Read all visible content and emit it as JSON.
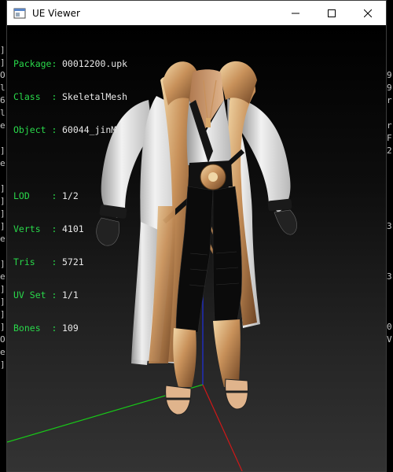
{
  "background_console": {
    "left_lines": [
      "]",
      "]",
      "O",
      "l",
      "6",
      "l",
      "e",
      "",
      "]",
      "e",
      "",
      "]",
      "]",
      "]",
      "]",
      "e",
      "",
      "]",
      "e",
      "]",
      "]",
      "]",
      "]",
      "O",
      "e",
      "]"
    ],
    "right_lines": [
      "9",
      "9",
      "r",
      "",
      "r",
      "F",
      "2",
      "",
      "",
      "",
      "",
      "",
      "3",
      "",
      "",
      "",
      "3",
      "",
      "",
      "",
      "0",
      "V"
    ]
  },
  "window": {
    "title": "UE Viewer",
    "icon": "ue-viewer-app-icon"
  },
  "controls": {
    "minimize_icon": "minimize-icon",
    "maximize_icon": "maximize-icon",
    "close_icon": "close-icon"
  },
  "info": {
    "package": {
      "label": "Package:",
      "value": "00012200.upk"
    },
    "class": {
      "label": "Class  :",
      "value": "SkeletalMesh"
    },
    "object": {
      "label": "Object :",
      "value": "60044_jinM"
    },
    "lod": {
      "label": "LOD    :",
      "value": "1/2"
    },
    "verts": {
      "label": "Verts  :",
      "value": "4101"
    },
    "tris": {
      "label": "Tris   :",
      "value": "5721"
    },
    "uvset": {
      "label": "UV Set :",
      "value": "1/1"
    },
    "bones": {
      "label": "Bones  :",
      "value": "109"
    }
  },
  "colors": {
    "info_label": "#29d84a",
    "axis_x": "#d01818",
    "axis_y": "#18c818",
    "axis_z": "#2030e0",
    "robe_white": "#e6e6e6",
    "gold": "#c8915a",
    "dark": "#0a0a0a"
  }
}
